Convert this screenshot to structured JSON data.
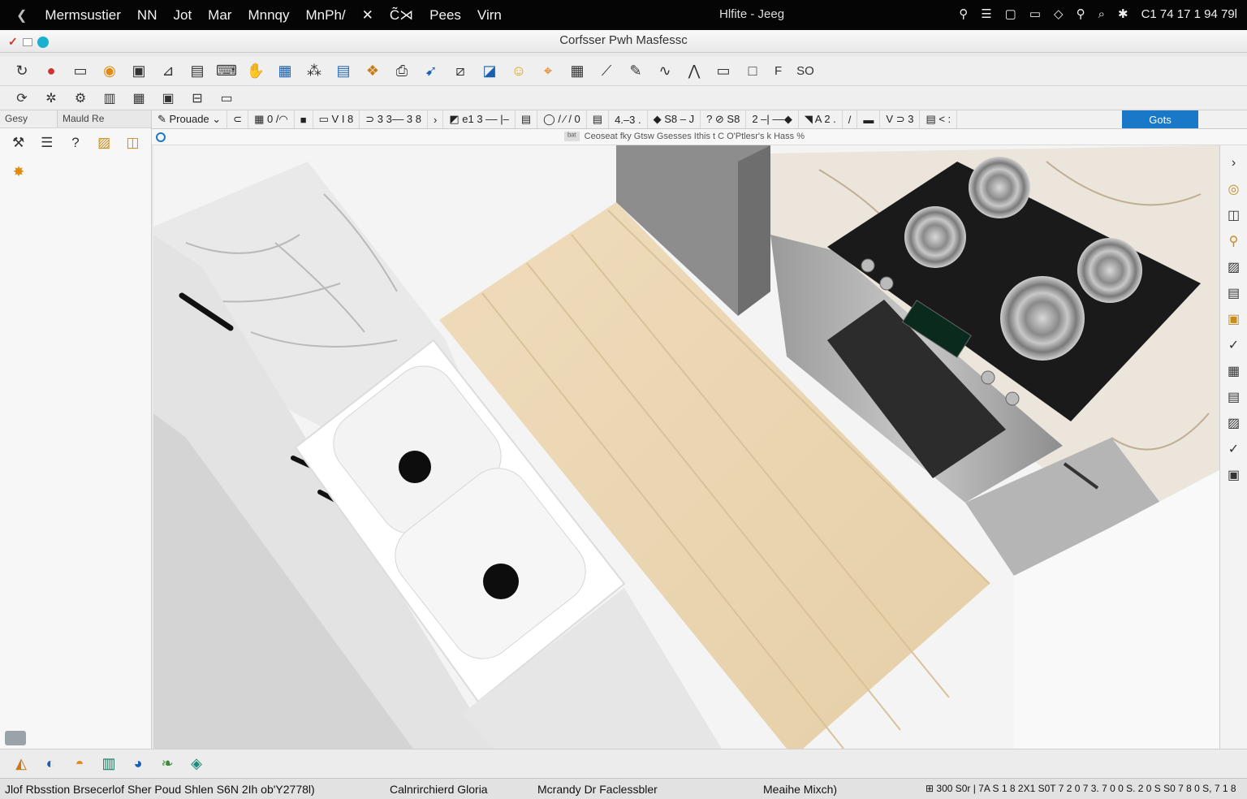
{
  "menubar": {
    "back_icon": "chevron-left-icon",
    "items": [
      "Mermsustier",
      "NN",
      "Jot",
      "Mar",
      "Mnnqy",
      "MnPh/",
      "✕",
      "C̃⋊",
      "Pees",
      "Virn"
    ],
    "center": "Hlfite -  Jeeg",
    "clock": "C1 74 17 1 94 79l"
  },
  "window": {
    "title": "Corfsser Pwh Masfessc"
  },
  "toolbar1": {
    "trailing": [
      "F",
      "SO"
    ]
  },
  "left_panel": {
    "tab1": "Gesy",
    "tab2": "Mauld Re"
  },
  "secondary_toolbar": {
    "items": [
      "✎  Prouade ⌄",
      "⊂",
      "▦ 0 /◠",
      "■",
      "▭ V I 8",
      "⊃ 3 3–– 3 8",
      "›",
      "◩ e1 3 –– |–",
      "▤",
      "◯ / ⁄ / 0",
      "▤",
      "4.–3 .",
      "◆ S8 – J",
      "? ⊘ S8",
      "2 –| ––◆",
      "◥ A 2 .",
      "/",
      "▬",
      "V ⊃ 3",
      "▤ < :"
    ],
    "highlight": "Gots"
  },
  "info_bar": {
    "label": "ᵇᵃᵗ",
    "message": "Ceoseat fky Gtsw Gsesses Ithis t C O'Ptlesr's k Hass %"
  },
  "status_bar": {
    "left": "Jlof Rbsstion Brsecerlof Sher Poud Shlen S6N 2Ih ob'Y2778l)",
    "middle": "Calnrirchierd Gloria",
    "middle2": "Mcrandy Dr Faclessbler",
    "right1": "Meaihe Mixch)",
    "right2": "⊞ 300 S0r | 7A S 1 8 2X1  S0T 7 2 0 7 3. 7 0 0 S. 2 0 S S0 7 8 0 S, 7 1 8"
  }
}
